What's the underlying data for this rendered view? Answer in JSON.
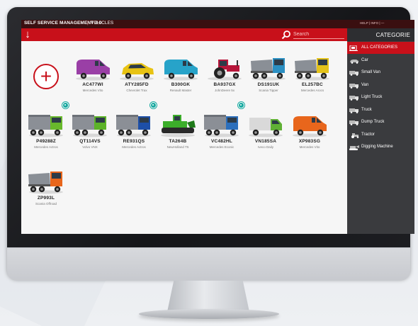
{
  "app": {
    "title": "SELF SERVICE MANAGEMENT 2.0",
    "separator": "|",
    "section": "VEHICLES",
    "top_links": "HELP | INFO | —"
  },
  "search": {
    "placeholder": "Search"
  },
  "sidebar": {
    "header": "CATEGORIE",
    "items": [
      {
        "label": "ALL CATEGORIES",
        "active": true,
        "icon": "all-categories-icon"
      },
      {
        "label": "Car",
        "active": false,
        "icon": "car-icon"
      },
      {
        "label": "Small Van",
        "active": false,
        "icon": "small-van-icon"
      },
      {
        "label": "Van",
        "active": false,
        "icon": "van-icon"
      },
      {
        "label": "Light Truck",
        "active": false,
        "icon": "light-truck-icon"
      },
      {
        "label": "Truck",
        "active": false,
        "icon": "truck-icon"
      },
      {
        "label": "Dump Truck",
        "active": false,
        "icon": "dump-truck-icon"
      },
      {
        "label": "Tractor",
        "active": false,
        "icon": "tractor-icon"
      },
      {
        "label": "Digging Machine",
        "active": false,
        "icon": "digging-machine-icon"
      }
    ]
  },
  "add_button": {
    "label": "+"
  },
  "vehicles": [
    {
      "plate": "AC477WI",
      "model": "Mercedes Vito",
      "type": "van",
      "color": "#9a3fa6",
      "badge": false
    },
    {
      "plate": "ATY285FD",
      "model": "Chevrolet Trax",
      "type": "car",
      "color": "#e8c313",
      "badge": false
    },
    {
      "plate": "B300GK",
      "model": "Renault Master",
      "type": "small-van",
      "color": "#27a3c9",
      "badge": false
    },
    {
      "plate": "BA937GX",
      "model": "JohnDeere 5x",
      "type": "tractor",
      "color": "#b7163a",
      "badge": false
    },
    {
      "plate": "DS191UK",
      "model": "Scania Tipper",
      "type": "dump-truck",
      "color": "#2b8fc2",
      "badge": false
    },
    {
      "plate": "EL257BC",
      "model": "Mercedes Arocs",
      "type": "dump-truck",
      "color": "#e3c21a",
      "badge": false
    },
    {
      "plate": "P49288Z",
      "model": "Mercedes Actros",
      "type": "truck",
      "color": "#68b82c",
      "badge": true
    },
    {
      "plate": "QT114VS",
      "model": "Volvo VNX",
      "type": "truck",
      "color": "#5cb328",
      "badge": false
    },
    {
      "plate": "RE931QS",
      "model": "Mercedes Actros",
      "type": "truck",
      "color": "#1d4fa8",
      "badge": true
    },
    {
      "plate": "TA264B",
      "model": "NewHolland T5",
      "type": "digging-machine",
      "color": "#3cae2a",
      "badge": false
    },
    {
      "plate": "VC482HL",
      "model": "Mercedes Econic",
      "type": "truck",
      "color": "#2c6fbc",
      "badge": true
    },
    {
      "plate": "VN185SA",
      "model": "Iveco Daily",
      "type": "light-truck",
      "color": "#5fb035",
      "badge": false
    },
    {
      "plate": "XP983SG",
      "model": "Mercedes Vito",
      "type": "van",
      "color": "#e8661c",
      "badge": false
    },
    {
      "plate": "ZP993L",
      "model": "Scania Offroad",
      "type": "dump-truck",
      "color": "#e8661c",
      "badge": false
    }
  ],
  "colors": {
    "accent": "#c8101a",
    "sidebar": "#3a3b3e",
    "topbar": "#3a0f10",
    "badge": "#1aa9a0"
  }
}
